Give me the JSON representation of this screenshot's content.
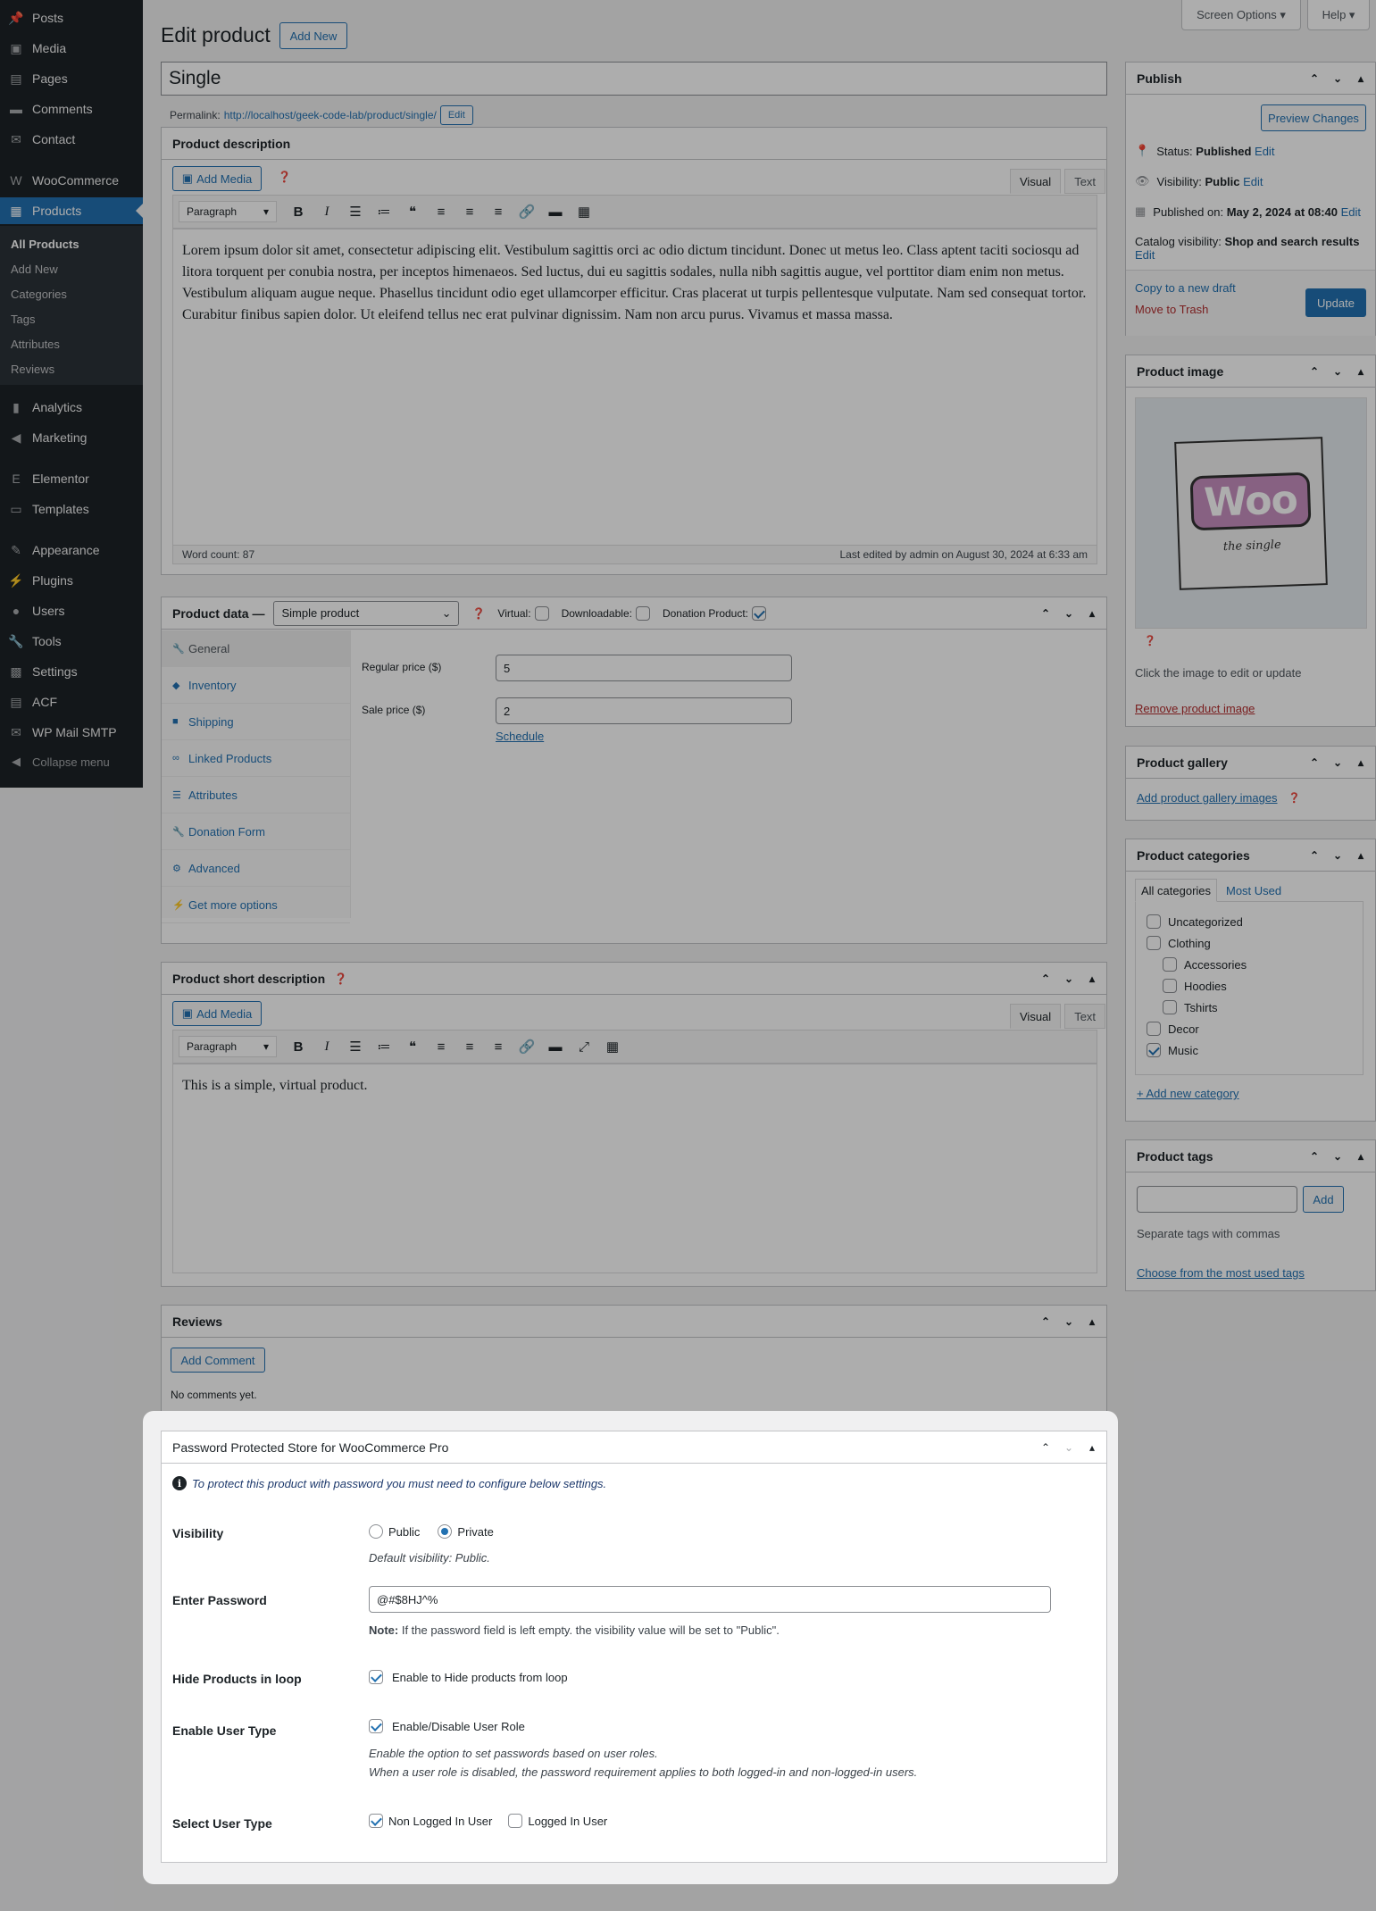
{
  "sidebar": {
    "items": [
      {
        "label": "Posts",
        "icon": "pin-icon"
      },
      {
        "label": "Media",
        "icon": "media-icon"
      },
      {
        "label": "Pages",
        "icon": "pages-icon"
      },
      {
        "label": "Comments",
        "icon": "comments-icon"
      },
      {
        "label": "Contact",
        "icon": "mail-icon"
      },
      {
        "label": "WooCommerce",
        "icon": "woo-icon"
      },
      {
        "label": "Products",
        "icon": "archive-icon"
      },
      {
        "label": "Analytics",
        "icon": "chart-icon"
      },
      {
        "label": "Marketing",
        "icon": "megaphone-icon"
      },
      {
        "label": "Elementor",
        "icon": "elementor-icon"
      },
      {
        "label": "Templates",
        "icon": "folder-icon"
      },
      {
        "label": "Appearance",
        "icon": "brush-icon"
      },
      {
        "label": "Plugins",
        "icon": "plugin-icon"
      },
      {
        "label": "Users",
        "icon": "users-icon"
      },
      {
        "label": "Tools",
        "icon": "wrench-icon"
      },
      {
        "label": "Settings",
        "icon": "settings-icon"
      },
      {
        "label": "ACF",
        "icon": "acf-icon"
      },
      {
        "label": "WP Mail SMTP",
        "icon": "mail-smtp-icon"
      }
    ],
    "submenu": [
      "All Products",
      "Add New",
      "Categories",
      "Tags",
      "Attributes",
      "Reviews"
    ],
    "collapse": "Collapse menu"
  },
  "top": {
    "screen_options": "Screen Options ▾",
    "help": "Help ▾"
  },
  "page": {
    "title": "Edit product",
    "add_new": "Add New"
  },
  "post": {
    "title": "Single",
    "permalink_label": "Permalink:",
    "permalink_url": "http://localhost/geek-code-lab/product/single/",
    "permalink_edit": "Edit"
  },
  "description": {
    "heading": "Product description",
    "add_media": "Add Media",
    "tab_visual": "Visual",
    "tab_text": "Text",
    "format": "Paragraph",
    "content": "Lorem ipsum dolor sit amet, consectetur adipiscing elit. Vestibulum sagittis orci ac odio dictum tincidunt. Donec ut metus leo. Class aptent taciti sociosqu ad litora torquent per conubia nostra, per inceptos himenaeos. Sed luctus, dui eu sagittis sodales, nulla nibh sagittis augue, vel porttitor diam enim non metus. Vestibulum aliquam augue neque. Phasellus tincidunt odio eget ullamcorper efficitur. Cras placerat ut turpis pellentesque vulputate. Nam sed consequat tortor. Curabitur finibus sapien dolor. Ut eleifend tellus nec erat pulvinar dignissim. Nam non arcu purus. Vivamus et massa massa.",
    "word_count": "Word count: 87",
    "last_edited": "Last edited by admin on August 30, 2024 at 6:33 am"
  },
  "product_data": {
    "heading": "Product data —",
    "type": "Simple product",
    "virtual_label": "Virtual:",
    "downloadable_label": "Downloadable:",
    "donation_label": "Donation Product:",
    "tabs": [
      "General",
      "Inventory",
      "Shipping",
      "Linked Products",
      "Attributes",
      "Donation Form",
      "Advanced",
      "Get more options"
    ],
    "regular_price_label": "Regular price ($)",
    "regular_price": "5",
    "sale_price_label": "Sale price ($)",
    "sale_price": "2",
    "schedule": "Schedule"
  },
  "short_desc": {
    "heading": "Product short description",
    "add_media": "Add Media",
    "tab_visual": "Visual",
    "tab_text": "Text",
    "format": "Paragraph",
    "content": "This is a simple, virtual product."
  },
  "reviews": {
    "heading": "Reviews",
    "add_comment": "Add Comment",
    "empty": "No comments yet."
  },
  "publish": {
    "heading": "Publish",
    "preview": "Preview Changes",
    "status_label": "Status:",
    "status_value": "Published",
    "visibility_label": "Visibility:",
    "visibility_value": "Public",
    "published_label": "Published on:",
    "published_value": "May 2, 2024 at 08:40",
    "edit": "Edit",
    "catalog_label": "Catalog visibility:",
    "catalog_value": "Shop and search results",
    "copy_draft": "Copy to a new draft",
    "trash": "Move to Trash",
    "update": "Update"
  },
  "product_image": {
    "heading": "Product image",
    "logo_text": "Woo",
    "logo_sub": "the single",
    "hint": "Click the image to edit or update",
    "remove": "Remove product image"
  },
  "gallery": {
    "heading": "Product gallery",
    "add": "Add product gallery images"
  },
  "categories": {
    "heading": "Product categories",
    "tab_all": "All categories",
    "tab_most": "Most Used",
    "items": [
      {
        "label": "Uncategorized",
        "checked": false,
        "level": 0
      },
      {
        "label": "Clothing",
        "checked": false,
        "level": 0
      },
      {
        "label": "Accessories",
        "checked": false,
        "level": 1
      },
      {
        "label": "Hoodies",
        "checked": false,
        "level": 1
      },
      {
        "label": "Tshirts",
        "checked": false,
        "level": 1
      },
      {
        "label": "Decor",
        "checked": false,
        "level": 0
      },
      {
        "label": "Music",
        "checked": true,
        "level": 0
      }
    ],
    "add_new": "+ Add new category"
  },
  "tags": {
    "heading": "Product tags",
    "add": "Add",
    "hint": "Separate tags with commas",
    "choose": "Choose from the most used tags"
  },
  "password_box": {
    "heading": "Password Protected Store for WooCommerce Pro",
    "notice": "To protect this product with password you must need to configure below settings.",
    "visibility_label": "Visibility",
    "public": "Public",
    "private": "Private",
    "visibility_selected": "Private",
    "visibility_default": "Default visibility: Public.",
    "password_label": "Enter Password",
    "password_value": "@#$8HJ^%",
    "note_bold": "Note:",
    "note_text": "If the password field is left empty. the visibility value will be set to \"Public\".",
    "hide_label": "Hide Products in loop",
    "hide_cb": "Enable to Hide products from loop",
    "user_type_label": "Enable User Type",
    "user_type_cb": "Enable/Disable User Role",
    "user_type_help1": "Enable the option to set passwords based on user roles.",
    "user_type_help2": "When a user role is disabled, the password requirement applies to both logged-in and non-logged-in users.",
    "select_label": "Select User Type",
    "non_logged": "Non Logged In User",
    "logged": "Logged In User"
  },
  "colors": {
    "accent": "#2271b1",
    "sidebar": "#1d2327",
    "link_danger": "#b32d2e"
  }
}
